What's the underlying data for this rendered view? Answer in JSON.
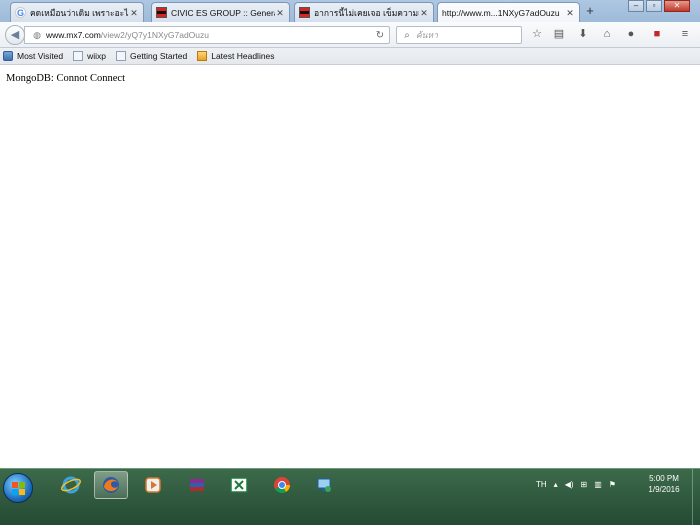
{
  "tabs": [
    {
      "title": "คดเหมือนว่าเดิม เพราะอะไร -...",
      "icon": "google-icon",
      "active": false
    },
    {
      "title": "CIVIC ES GROUP :: General...",
      "icon": "site-flag-icon",
      "active": false
    },
    {
      "title": "อาการนี้ไม่เคยเจอ เข็มความเ...",
      "icon": "site-flag-icon",
      "active": false
    },
    {
      "title": "http://www.m...1NXyG7adOuzu",
      "icon": "none",
      "active": true
    }
  ],
  "navbar": {
    "url_domain": "www.mx7.com",
    "url_path": "/view2/yQ7y1NXyG7adOuzu",
    "search_placeholder": "ค้นหา"
  },
  "bookmarks": [
    {
      "label": "Most Visited",
      "icon": "most-visited-icon"
    },
    {
      "label": "wiixp",
      "icon": "page-icon"
    },
    {
      "label": "Getting Started",
      "icon": "page-icon"
    },
    {
      "label": "Latest Headlines",
      "icon": "rss-icon"
    }
  ],
  "page": {
    "message": "MongoDB: Connot Connect"
  },
  "taskbar": {
    "language": "TH",
    "time": "5:00 PM",
    "date": "1/9/2016"
  }
}
